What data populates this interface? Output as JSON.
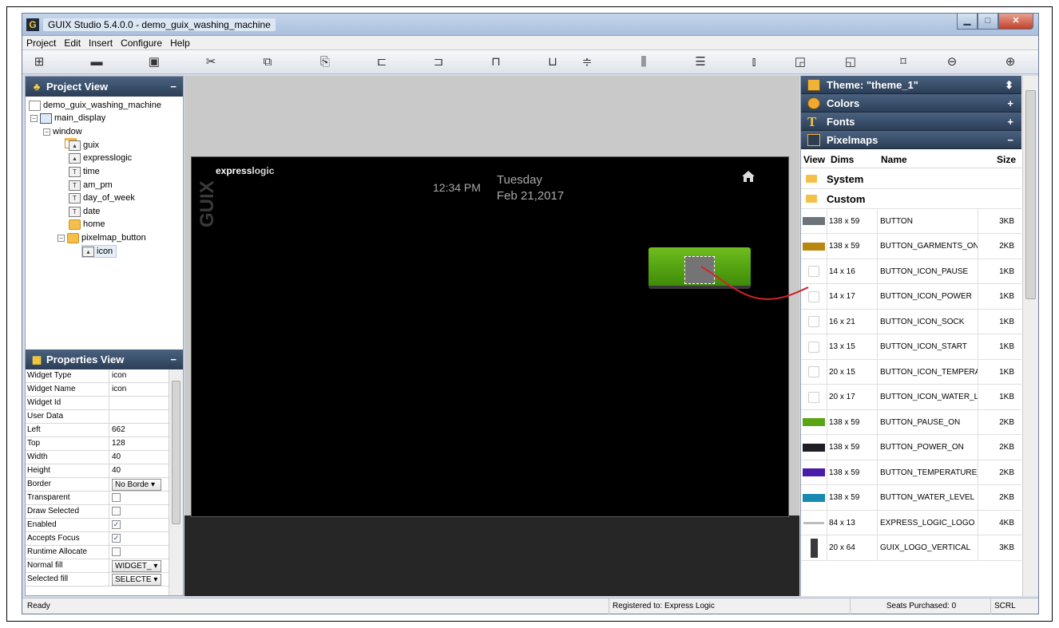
{
  "window": {
    "title": "GUIX Studio 5.4.0.0 - demo_guix_washing_machine",
    "app_icon_label": "G"
  },
  "menu": [
    "Project",
    "Edit",
    "Insert",
    "Configure",
    "Help"
  ],
  "toolbar": {
    "icons": [
      "new-icon",
      "open-icon",
      "save-icon",
      "cut-icon",
      "copy-icon",
      "paste-icon",
      "align-left-icon",
      "align-right-icon",
      "align-top-icon",
      "align-bottom-icon",
      "v-center-icon",
      "h-space-icon",
      "v-space-icon",
      "equal-width-icon",
      "equal-height-icon",
      "size-to-fit-icon",
      "zoom-fit-icon",
      "zoom-out-icon",
      "zoom-in-icon"
    ]
  },
  "project_view": {
    "title": "Project View",
    "collapse": "−",
    "items": [
      {
        "label": "demo_guix_washing_machine",
        "level": 0,
        "icon": "project-file-icon"
      },
      {
        "label": "main_display",
        "level": 1,
        "icon": "display-icon",
        "expander": "−"
      },
      {
        "label": "window",
        "level": 2,
        "icon": "window-icon",
        "expander": "−"
      },
      {
        "label": "guix",
        "level": 3,
        "icon": "icon-widget-icon"
      },
      {
        "label": "expresslogic",
        "level": 3,
        "icon": "icon-widget-icon"
      },
      {
        "label": "time",
        "level": 3,
        "icon": "text-widget-icon"
      },
      {
        "label": "am_pm",
        "level": 3,
        "icon": "text-widget-icon"
      },
      {
        "label": "day_of_week",
        "level": 3,
        "icon": "text-widget-icon"
      },
      {
        "label": "date",
        "level": 3,
        "icon": "text-widget-icon"
      },
      {
        "label": "home",
        "level": 3,
        "icon": "button-widget-icon"
      },
      {
        "label": "pixelmap_button",
        "level": 3,
        "icon": "button-widget-icon",
        "expander": "−"
      },
      {
        "label": "icon",
        "level": 4,
        "icon": "icon-widget-icon"
      }
    ]
  },
  "properties_view": {
    "title": "Properties View",
    "collapse": "−",
    "rows": [
      {
        "name": "Widget Type",
        "value": "icon",
        "kind": "text"
      },
      {
        "name": "Widget Name",
        "value": "icon",
        "kind": "text"
      },
      {
        "name": "Widget Id",
        "value": "",
        "kind": "text"
      },
      {
        "name": "User Data",
        "value": "",
        "kind": "text"
      },
      {
        "name": "Left",
        "value": "662",
        "kind": "text"
      },
      {
        "name": "Top",
        "value": "128",
        "kind": "text"
      },
      {
        "name": "Width",
        "value": "40",
        "kind": "text"
      },
      {
        "name": "Height",
        "value": "40",
        "kind": "text"
      },
      {
        "name": "Border",
        "value": "No Borde ▾",
        "kind": "combo"
      },
      {
        "name": "Transparent",
        "value": "",
        "kind": "check",
        "checked": false
      },
      {
        "name": "Draw Selected",
        "value": "",
        "kind": "check",
        "checked": false
      },
      {
        "name": "Enabled",
        "value": "✓",
        "kind": "check",
        "checked": true
      },
      {
        "name": "Accepts Focus",
        "value": "✓",
        "kind": "check",
        "checked": true
      },
      {
        "name": "Runtime Allocate",
        "value": "",
        "kind": "check",
        "checked": false
      },
      {
        "name": "Normal fill",
        "value": "WIDGET_ ▾",
        "kind": "combo"
      },
      {
        "name": "Selected fill",
        "value": "SELECTE ▾",
        "kind": "combo"
      }
    ]
  },
  "canvas": {
    "logo_bold": "express",
    "logo_light": "logic",
    "guix_vertical": "GUIX",
    "time": "12:34 PM",
    "day_of_week": "Tuesday",
    "date": "Feb 21,2017"
  },
  "right_panel": {
    "theme_title": "Theme: \"theme_1\"",
    "theme_toggle": "⬍",
    "sections": [
      {
        "label": "Colors",
        "toggle": "+"
      },
      {
        "label": "Fonts",
        "toggle": "+"
      },
      {
        "label": "Pixelmaps",
        "toggle": "−"
      }
    ],
    "columns": {
      "view": "View",
      "dims": "Dims",
      "name": "Name",
      "size": "Size"
    },
    "groups": [
      "System",
      "Custom"
    ],
    "pixelmaps": [
      {
        "dims": "138 x 59",
        "name": "BUTTON",
        "size": "3KB",
        "color": "#6d7479",
        "kind": "swatch"
      },
      {
        "dims": "138 x 59",
        "name": "BUTTON_GARMENTS_ON",
        "size": "2KB",
        "color": "#b8870f",
        "kind": "swatch"
      },
      {
        "dims": "14 x 16",
        "name": "BUTTON_ICON_PAUSE",
        "size": "1KB",
        "color": "#e6e6e6",
        "kind": "icon"
      },
      {
        "dims": "14 x 17",
        "name": "BUTTON_ICON_POWER",
        "size": "1KB",
        "color": "#e6e6e6",
        "kind": "icon"
      },
      {
        "dims": "16 x 21",
        "name": "BUTTON_ICON_SOCK",
        "size": "1KB",
        "color": "#e6e6e6",
        "kind": "icon"
      },
      {
        "dims": "13 x 15",
        "name": "BUTTON_ICON_START",
        "size": "1KB",
        "color": "#e6e6e6",
        "kind": "icon"
      },
      {
        "dims": "20 x 15",
        "name": "BUTTON_ICON_TEMPERAT",
        "size": "1KB",
        "color": "#e6e6e6",
        "kind": "icon"
      },
      {
        "dims": "20 x 17",
        "name": "BUTTON_ICON_WATER_L",
        "size": "1KB",
        "color": "#e6e6e6",
        "kind": "icon"
      },
      {
        "dims": "138 x 59",
        "name": "BUTTON_PAUSE_ON",
        "size": "2KB",
        "color": "#5aa514",
        "kind": "swatch"
      },
      {
        "dims": "138 x 59",
        "name": "BUTTON_POWER_ON",
        "size": "2KB",
        "color": "#1d1d24",
        "kind": "swatch"
      },
      {
        "dims": "138 x 59",
        "name": "BUTTON_TEMPERATURE_",
        "size": "2KB",
        "color": "#4a1aa8",
        "kind": "swatch"
      },
      {
        "dims": "138 x 59",
        "name": "BUTTON_WATER_LEVEL",
        "size": "2KB",
        "color": "#1989b0",
        "kind": "swatch"
      },
      {
        "dims": "84 x 13",
        "name": "EXPRESS_LOGIC_LOGO",
        "size": "4KB",
        "color": "#bdbdbd",
        "kind": "logo"
      },
      {
        "dims": "20 x 64",
        "name": "GUIX_LOGO_VERTICAL",
        "size": "3KB",
        "color": "#3a3a3a",
        "kind": "guix"
      }
    ]
  },
  "status": {
    "ready": "Ready",
    "registered": "Registered to: Express Logic",
    "seats": "Seats Purchased: 0",
    "scrl": "SCRL"
  },
  "colors": {
    "selection_line": "#d3232a",
    "panel_header": "#2c3e57",
    "canvas_bg": "#000000"
  }
}
